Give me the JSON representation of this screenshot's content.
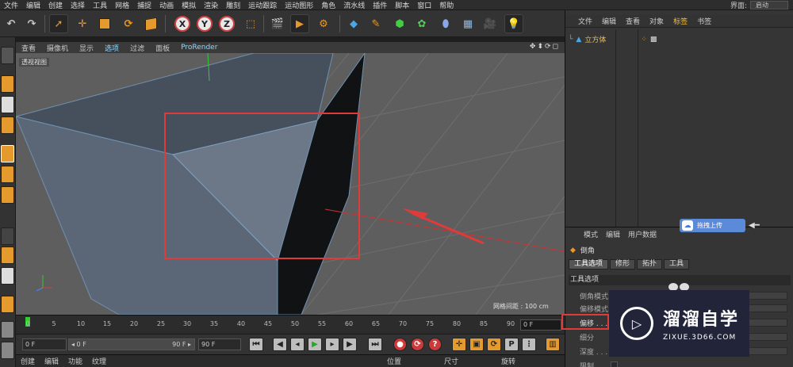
{
  "menubar": {
    "items": [
      "文件",
      "编辑",
      "创建",
      "选择",
      "工具",
      "网格",
      "捕捉",
      "动画",
      "模拟",
      "渲染",
      "雕刻",
      "运动跟踪",
      "运动图形",
      "角色",
      "流水线",
      "插件",
      "脚本",
      "窗口",
      "帮助"
    ],
    "layout_label": "界面:",
    "layout_value": "启动"
  },
  "toolbar": {
    "axis_x": "X",
    "axis_y": "Y",
    "axis_z": "Z"
  },
  "viewport": {
    "menu": [
      "查看",
      "摄像机",
      "显示",
      "选项",
      "过滤",
      "面板",
      "ProRender"
    ],
    "active_menu_index": 3,
    "view_label": "透视视图",
    "nav_icons": "✥⬍⟳◻",
    "grid_distance": "网格间距 : 100 cm"
  },
  "timeline": {
    "ticks": [
      "0",
      "5",
      "10",
      "15",
      "20",
      "25",
      "30",
      "35",
      "40",
      "45",
      "50",
      "55",
      "60",
      "65",
      "70",
      "75",
      "80",
      "85",
      "90"
    ],
    "current_frame": "0 F"
  },
  "transport": {
    "start": "0 F",
    "range_start": "◂ 0 F",
    "range_end": "90 F ▸",
    "end": "90 F"
  },
  "bottom": {
    "menu": [
      "创建",
      "编辑",
      "功能",
      "纹理"
    ],
    "coords": [
      "位置",
      "尺寸",
      "旋转"
    ]
  },
  "object_manager": {
    "menu": [
      "文件",
      "编辑",
      "查看",
      "对象",
      "标签",
      "书签"
    ],
    "active_menu_index": 4,
    "object_name": "立方体"
  },
  "attributes": {
    "menu": [
      "模式",
      "编辑",
      "用户数据"
    ],
    "tool_name": "倒角",
    "tabs": [
      "工具选项",
      "修形",
      "拓扑",
      "工具"
    ],
    "section": "工具选项",
    "props": [
      "倒角模式",
      "偏移模式",
      "偏移 . . . . .",
      "细分",
      "深度 . . . . .",
      "限制"
    ]
  },
  "upload": {
    "label": "拖拽上传"
  },
  "watermark": {
    "title": "溜溜自学",
    "url": "ZIXUE.3D66.COM"
  },
  "colors": {
    "accent_orange": "#e59a2e",
    "annotation_red": "#e03b3b",
    "active_tab": "#f0c040",
    "viewport_bg": "#5e5e5e"
  }
}
